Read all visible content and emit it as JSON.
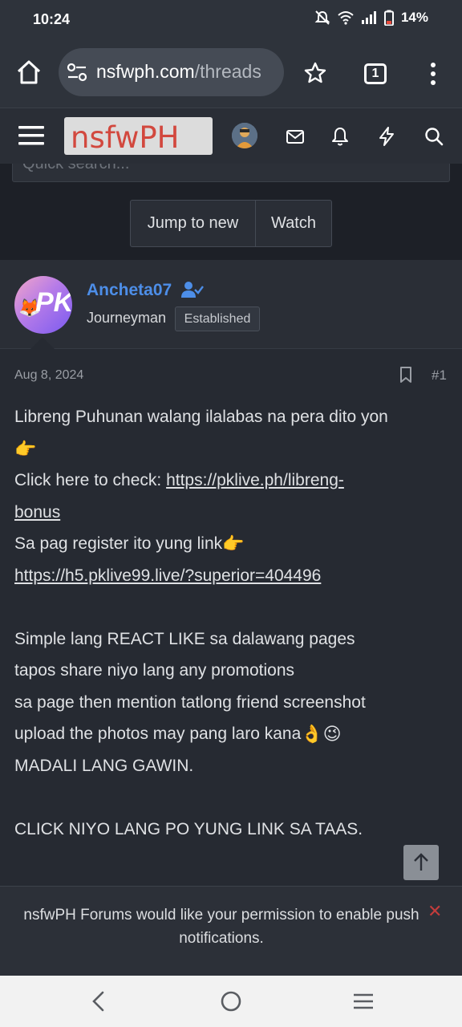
{
  "status_bar": {
    "time": "10:24",
    "battery": "14%",
    "icons": [
      "mute-icon",
      "wifi-icon",
      "signal-icon",
      "battery-icon"
    ]
  },
  "browser": {
    "url_domain": "nsfwph.com",
    "url_path": "/threads",
    "tab_count": "1"
  },
  "site_header": {
    "logo_text": "nsfwPH",
    "logo_color": "#d2483e",
    "icons": [
      "menu-icon",
      "avatar",
      "mail-icon",
      "bell-icon",
      "lightning-icon",
      "search-icon"
    ]
  },
  "search": {
    "placeholder": "Quick search..."
  },
  "thread_buttons": {
    "jump_label": "Jump to new",
    "watch_label": "Watch"
  },
  "post": {
    "author": "Ancheta07",
    "author_color": "#4d8ee8",
    "user_title": "Journeyman",
    "banner": "Established",
    "avatar_text": "PK",
    "date": "Aug 8, 2024",
    "number": "#1",
    "lines": {
      "l1": "Libreng Puhunan walang ilalabas na pera dito yon",
      "l2_emoji": "👉",
      "l3_text": "Click here to check: ",
      "l3_link": "https://pklive.ph/libreng-",
      "l4_link": "bonus",
      "l5_text": "Sa pag register ito yung link",
      "l5_emoji": "👉",
      "l6_link": "https://h5.pklive99.live/?superior=404496",
      "l8": "Simple lang REACT LIKE sa dalawang pages",
      "l9": "tapos share niyo lang any promotions",
      "l10": "sa page then mention tatlong friend screenshot",
      "l11_text": "upload the photos may pang laro kana",
      "l11_emoji": "👌😉",
      "l12": "MADALI LANG GAWIN.",
      "l14": "CLICK NIYO LANG PO YUNG LINK SA TAAS."
    }
  },
  "notification": {
    "text": "nsfwPH Forums would like your permission to enable push notifications.",
    "close": "✕"
  },
  "android_nav": {
    "icons": [
      "back-icon",
      "home-circle-icon",
      "recents-icon"
    ]
  }
}
